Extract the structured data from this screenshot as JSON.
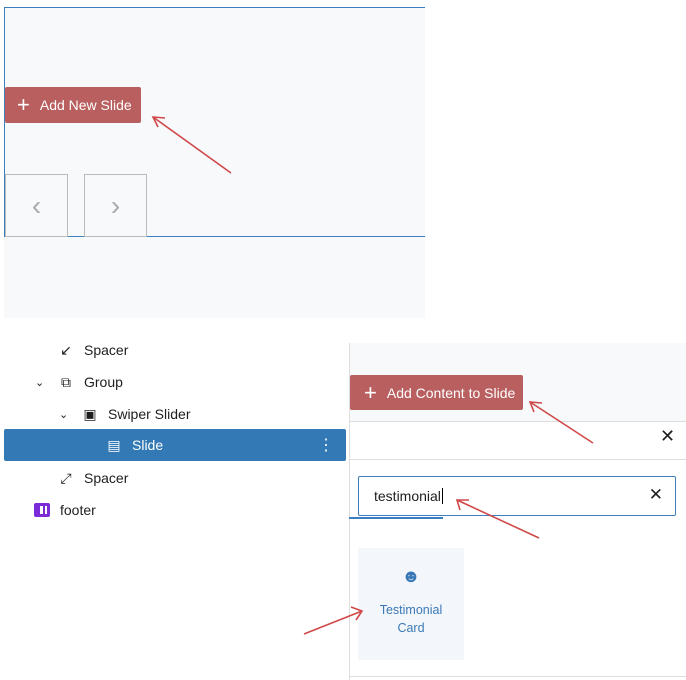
{
  "editor": {
    "add_slide_label": "Add New Slide",
    "prev_icon": "chevron-left-icon",
    "next_icon": "chevron-right-icon"
  },
  "list_view": {
    "items": [
      {
        "label": "Spacer",
        "icon": "spacer-icon"
      },
      {
        "label": "Group",
        "icon": "group-icon",
        "expanded": true
      },
      {
        "label": "Swiper Slider",
        "icon": "gallery-icon",
        "expanded": true
      },
      {
        "label": "Slide",
        "icon": "page-icon",
        "selected": true
      },
      {
        "label": "Spacer",
        "icon": "spacer-icon"
      },
      {
        "label": "footer",
        "icon": "template-part-icon"
      }
    ]
  },
  "inserter": {
    "add_content_label": "Add Content to Slide",
    "search_value": "testimonial",
    "results": [
      {
        "label": "Testimonial Card",
        "icon": "testimonial-icon"
      }
    ]
  },
  "colors": {
    "accent_red": "#b95f5f",
    "selection_blue": "#3379b5",
    "link_blue": "#3a78b5",
    "footer_purple": "#7b2ad8",
    "arrow": "#d04848"
  }
}
